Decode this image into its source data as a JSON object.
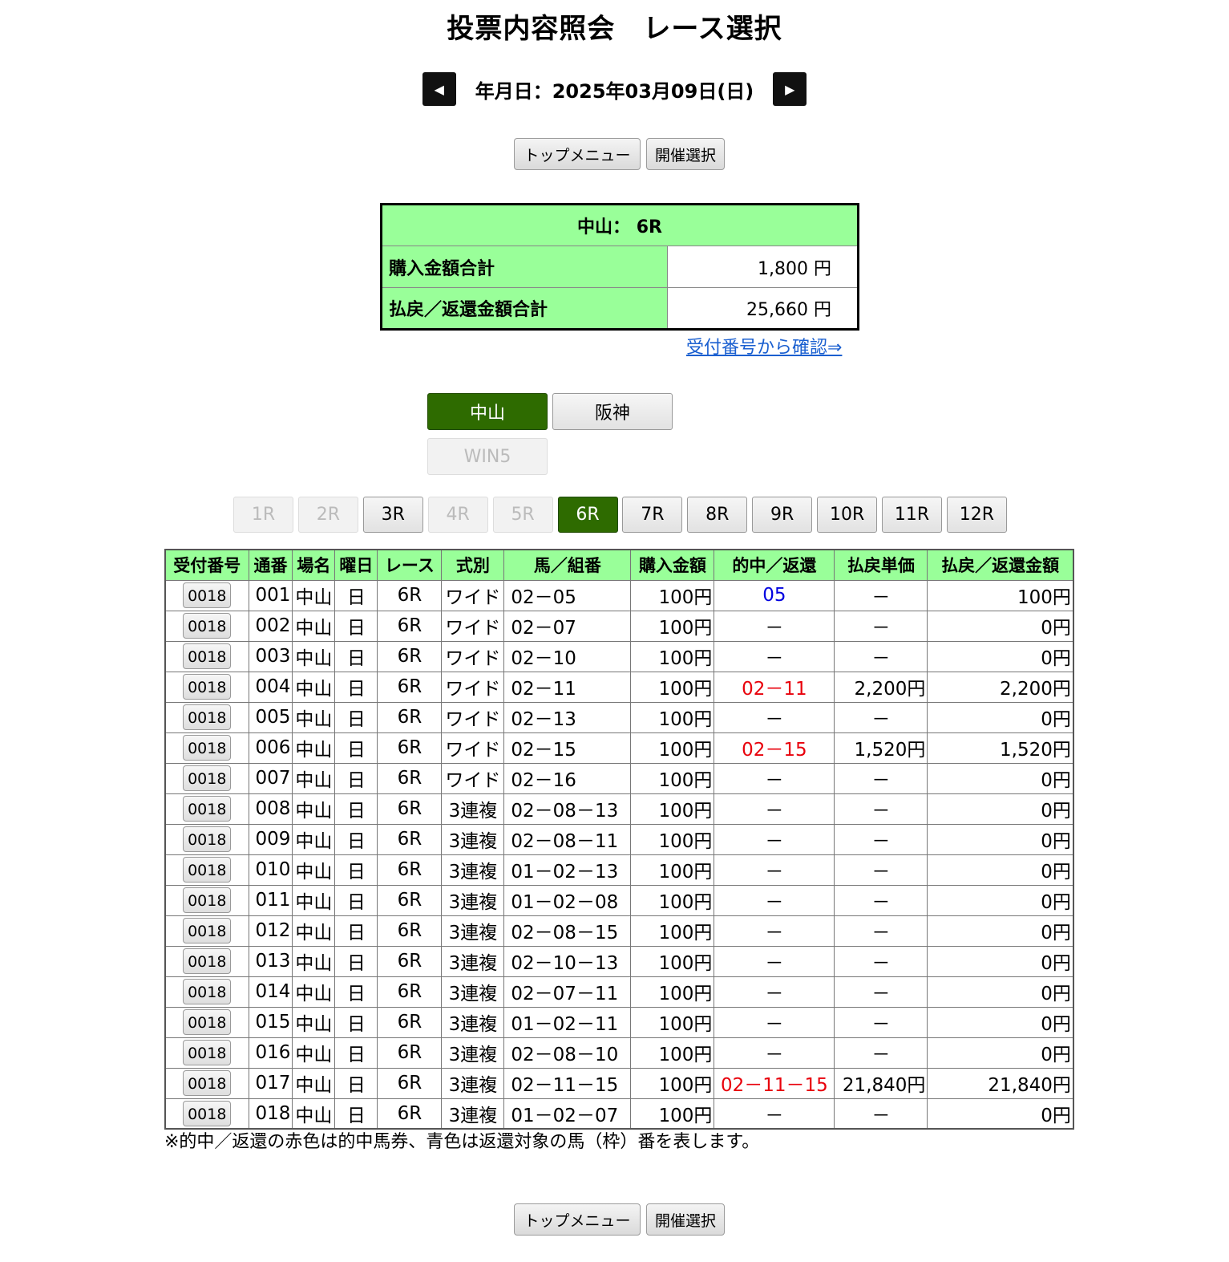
{
  "page_title": "投票内容照会　レース選択",
  "date_label": "年月日：2025年03月09日(日)",
  "prev_icon": "◀",
  "next_icon": "▶",
  "buttons": {
    "top_menu": "トップメニュー",
    "venue_select": "開催選択"
  },
  "summary": {
    "header": "中山：  6R",
    "purchase_label": "購入金額合計",
    "purchase_value": "1,800 円",
    "refund_label": "払戻／返還金額合計",
    "refund_value": "25,660 円"
  },
  "receipt_link": "受付番号から確認⇒",
  "venue_tabs": [
    {
      "label": "中山",
      "state": "active"
    },
    {
      "label": "阪神",
      "state": "normal"
    },
    {
      "label": "WIN5",
      "state": "disabled"
    }
  ],
  "race_tabs": [
    {
      "label": "1R",
      "state": "disabled"
    },
    {
      "label": "2R",
      "state": "disabled"
    },
    {
      "label": "3R",
      "state": "normal"
    },
    {
      "label": "4R",
      "state": "disabled"
    },
    {
      "label": "5R",
      "state": "disabled"
    },
    {
      "label": "6R",
      "state": "active"
    },
    {
      "label": "7R",
      "state": "normal"
    },
    {
      "label": "8R",
      "state": "normal"
    },
    {
      "label": "9R",
      "state": "normal"
    },
    {
      "label": "10R",
      "state": "normal"
    },
    {
      "label": "11R",
      "state": "normal"
    },
    {
      "label": "12R",
      "state": "normal"
    }
  ],
  "table": {
    "headers": [
      "受付番号",
      "通番",
      "場名",
      "曜日",
      "レース",
      "式別",
      "馬／組番",
      "購入金額",
      "的中／返還",
      "払戻単価",
      "払戻／返還金額"
    ],
    "rows": [
      {
        "receipt": "0018",
        "serial": "001",
        "venue": "中山",
        "day": "日",
        "race": "6R",
        "type": "ワイド",
        "combo": "02－05",
        "amount": "100円",
        "hit": "05",
        "hit_color": "blue",
        "unit": "－",
        "payout": "100円"
      },
      {
        "receipt": "0018",
        "serial": "002",
        "venue": "中山",
        "day": "日",
        "race": "6R",
        "type": "ワイド",
        "combo": "02－07",
        "amount": "100円",
        "hit": "－",
        "hit_color": "",
        "unit": "－",
        "payout": "0円"
      },
      {
        "receipt": "0018",
        "serial": "003",
        "venue": "中山",
        "day": "日",
        "race": "6R",
        "type": "ワイド",
        "combo": "02－10",
        "amount": "100円",
        "hit": "－",
        "hit_color": "",
        "unit": "－",
        "payout": "0円"
      },
      {
        "receipt": "0018",
        "serial": "004",
        "venue": "中山",
        "day": "日",
        "race": "6R",
        "type": "ワイド",
        "combo": "02－11",
        "amount": "100円",
        "hit": "02－11",
        "hit_color": "red",
        "unit": "2,200円",
        "payout": "2,200円"
      },
      {
        "receipt": "0018",
        "serial": "005",
        "venue": "中山",
        "day": "日",
        "race": "6R",
        "type": "ワイド",
        "combo": "02－13",
        "amount": "100円",
        "hit": "－",
        "hit_color": "",
        "unit": "－",
        "payout": "0円"
      },
      {
        "receipt": "0018",
        "serial": "006",
        "venue": "中山",
        "day": "日",
        "race": "6R",
        "type": "ワイド",
        "combo": "02－15",
        "amount": "100円",
        "hit": "02－15",
        "hit_color": "red",
        "unit": "1,520円",
        "payout": "1,520円"
      },
      {
        "receipt": "0018",
        "serial": "007",
        "venue": "中山",
        "day": "日",
        "race": "6R",
        "type": "ワイド",
        "combo": "02－16",
        "amount": "100円",
        "hit": "－",
        "hit_color": "",
        "unit": "－",
        "payout": "0円"
      },
      {
        "receipt": "0018",
        "serial": "008",
        "venue": "中山",
        "day": "日",
        "race": "6R",
        "type": "3連複",
        "combo": "02－08－13",
        "amount": "100円",
        "hit": "－",
        "hit_color": "",
        "unit": "－",
        "payout": "0円"
      },
      {
        "receipt": "0018",
        "serial": "009",
        "venue": "中山",
        "day": "日",
        "race": "6R",
        "type": "3連複",
        "combo": "02－08－11",
        "amount": "100円",
        "hit": "－",
        "hit_color": "",
        "unit": "－",
        "payout": "0円"
      },
      {
        "receipt": "0018",
        "serial": "010",
        "venue": "中山",
        "day": "日",
        "race": "6R",
        "type": "3連複",
        "combo": "01－02－13",
        "amount": "100円",
        "hit": "－",
        "hit_color": "",
        "unit": "－",
        "payout": "0円"
      },
      {
        "receipt": "0018",
        "serial": "011",
        "venue": "中山",
        "day": "日",
        "race": "6R",
        "type": "3連複",
        "combo": "01－02－08",
        "amount": "100円",
        "hit": "－",
        "hit_color": "",
        "unit": "－",
        "payout": "0円"
      },
      {
        "receipt": "0018",
        "serial": "012",
        "venue": "中山",
        "day": "日",
        "race": "6R",
        "type": "3連複",
        "combo": "02－08－15",
        "amount": "100円",
        "hit": "－",
        "hit_color": "",
        "unit": "－",
        "payout": "0円"
      },
      {
        "receipt": "0018",
        "serial": "013",
        "venue": "中山",
        "day": "日",
        "race": "6R",
        "type": "3連複",
        "combo": "02－10－13",
        "amount": "100円",
        "hit": "－",
        "hit_color": "",
        "unit": "－",
        "payout": "0円"
      },
      {
        "receipt": "0018",
        "serial": "014",
        "venue": "中山",
        "day": "日",
        "race": "6R",
        "type": "3連複",
        "combo": "02－07－11",
        "amount": "100円",
        "hit": "－",
        "hit_color": "",
        "unit": "－",
        "payout": "0円"
      },
      {
        "receipt": "0018",
        "serial": "015",
        "venue": "中山",
        "day": "日",
        "race": "6R",
        "type": "3連複",
        "combo": "01－02－11",
        "amount": "100円",
        "hit": "－",
        "hit_color": "",
        "unit": "－",
        "payout": "0円"
      },
      {
        "receipt": "0018",
        "serial": "016",
        "venue": "中山",
        "day": "日",
        "race": "6R",
        "type": "3連複",
        "combo": "02－08－10",
        "amount": "100円",
        "hit": "－",
        "hit_color": "",
        "unit": "－",
        "payout": "0円"
      },
      {
        "receipt": "0018",
        "serial": "017",
        "venue": "中山",
        "day": "日",
        "race": "6R",
        "type": "3連複",
        "combo": "02－11－15",
        "amount": "100円",
        "hit": "02－11－15",
        "hit_color": "red",
        "unit": "21,840円",
        "payout": "21,840円"
      },
      {
        "receipt": "0018",
        "serial": "018",
        "venue": "中山",
        "day": "日",
        "race": "6R",
        "type": "3連複",
        "combo": "01－02－07",
        "amount": "100円",
        "hit": "－",
        "hit_color": "",
        "unit": "－",
        "payout": "0円"
      }
    ]
  },
  "note": "※的中／返還の赤色は的中馬券、青色は返還対象の馬（枠）番を表します。",
  "colors": {
    "header_green": "#99ff99",
    "active_tab": "#2e6b00",
    "hit_red": "#e8000b",
    "refund_blue": "#0000e0",
    "link_blue": "#1a5fd0"
  }
}
